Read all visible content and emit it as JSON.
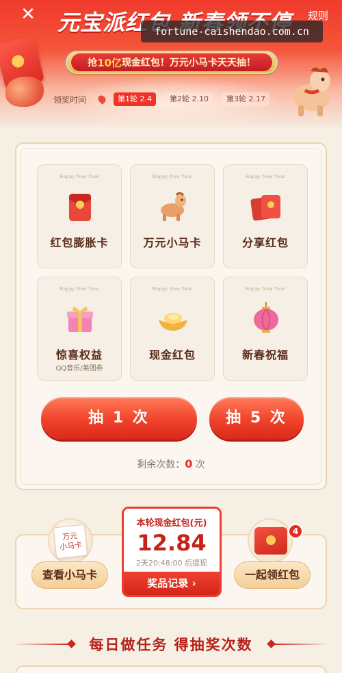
{
  "header": {
    "close_icon": "close-icon",
    "title": "元宝派红包 新春领不停",
    "rules": "规则",
    "watermark": "fortune-caishendao.com.cn",
    "banner_pre": "抢",
    "banner_highlight": "10亿",
    "banner_post": "现金红包！万元小马卡天天抽！"
  },
  "rounds": {
    "label": "领奖时间",
    "items": [
      "第1轮 2.4",
      "第2轮 2.10",
      "第3轮 2.17"
    ],
    "active_index": 0
  },
  "prizes": {
    "card_tag": "Happy New Year",
    "items": [
      {
        "title": "红包膨胀卡",
        "icon": "red-packet-icon"
      },
      {
        "title": "万元小马卡",
        "icon": "pony-icon"
      },
      {
        "title": "分享红包",
        "icon": "red-envelopes-icon"
      },
      {
        "title": "惊喜权益",
        "subtitle": "QQ音乐/美团券",
        "icon": "gift-box-icon"
      },
      {
        "title": "现金红包",
        "icon": "gold-ingot-icon"
      },
      {
        "title": "新春祝福",
        "icon": "lantern-icon"
      }
    ]
  },
  "draw": {
    "one_label": "抽 1 次",
    "five_label": "抽 5 次",
    "remain_prefix": "剩余次数：",
    "remain_count": "0",
    "remain_suffix": " 次"
  },
  "bottom": {
    "pony_card_text": "万元\n小马卡",
    "view_pony_label": "查看小马卡",
    "cash_label": "本轮现金红包(元)",
    "cash_amount": "12.84",
    "cash_timer": "2天20:48:00 后提现",
    "record_label": "奖品记录 ›",
    "together_label": "一起领红包",
    "together_badge": "4"
  },
  "section": {
    "title": "每日做任务  得抽奖次数"
  },
  "colors": {
    "brand_red": "#ee3428",
    "gold": "#f6b143",
    "cream": "#f6efe4"
  }
}
